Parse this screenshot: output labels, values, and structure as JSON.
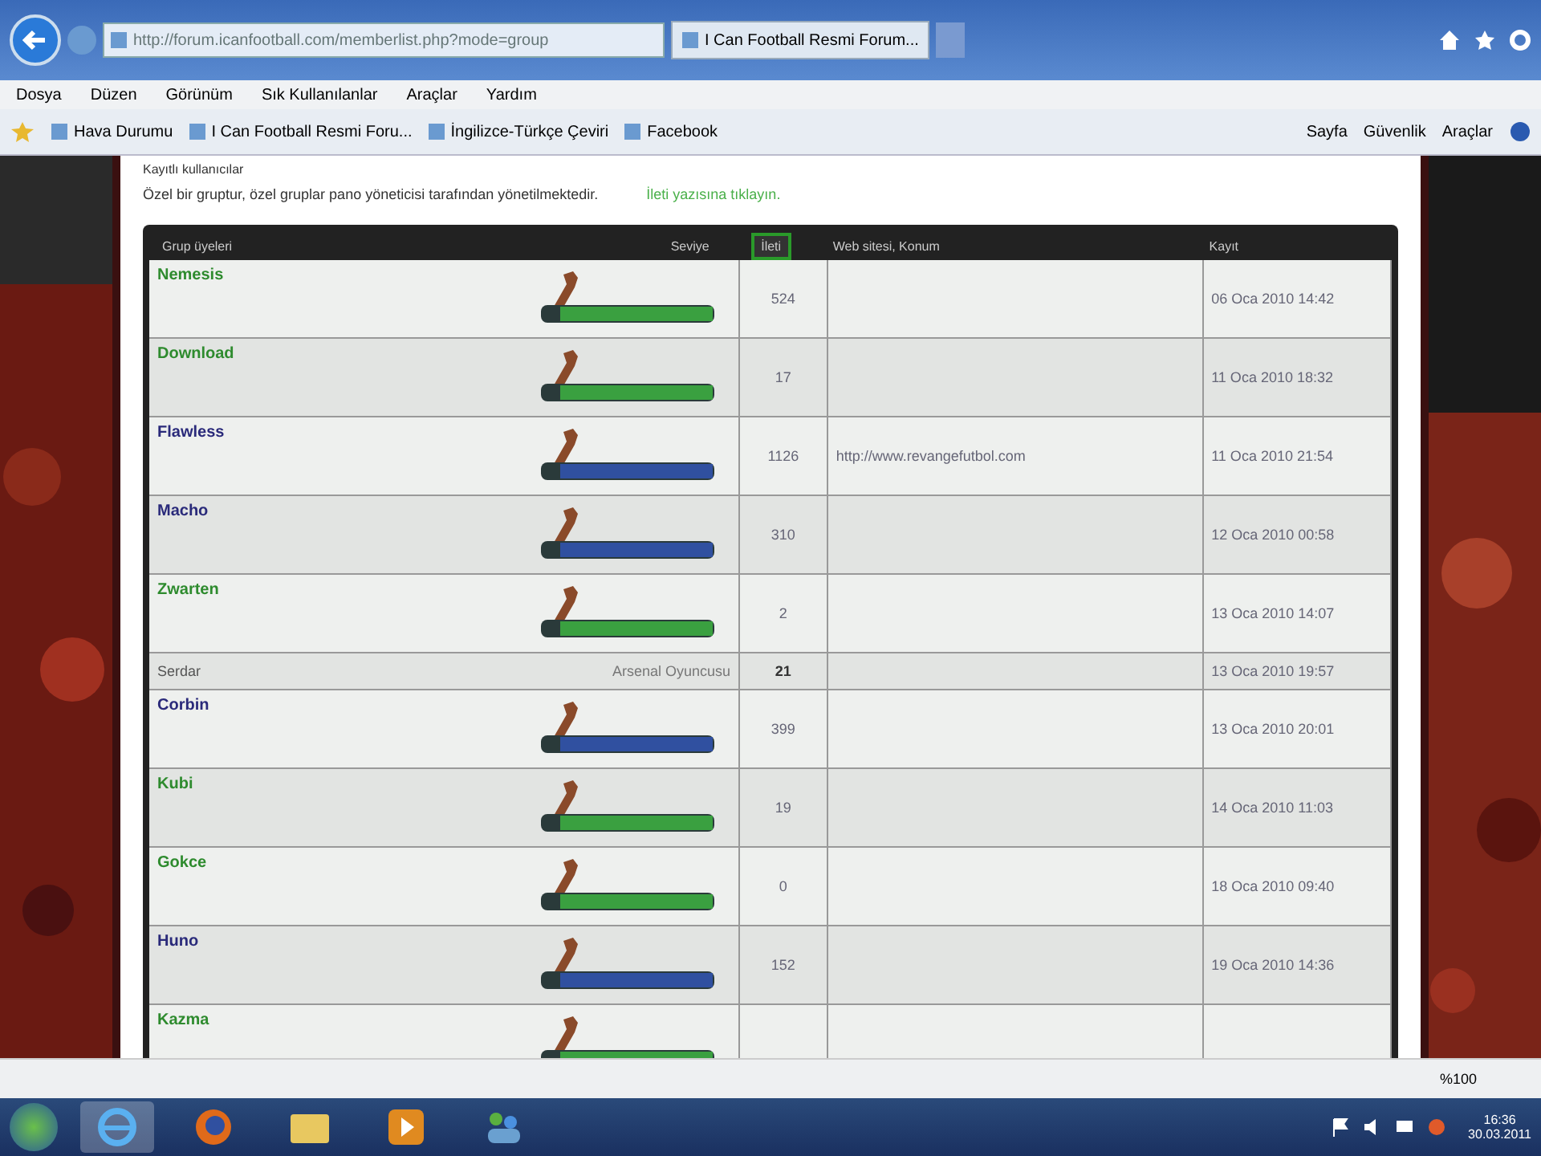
{
  "browser": {
    "address": "http://forum.icanfootball.com/memberlist.php?mode=group",
    "tab": "I Can Football Resmi Forum...",
    "menu": [
      "Dosya",
      "Düzen",
      "Görünüm",
      "Sık Kullanılanlar",
      "Araçlar",
      "Yardım"
    ],
    "favorites": [
      "Hava Durumu",
      "I Can Football Resmi Foru...",
      "İngilizce-Türkçe Çeviri",
      "Facebook"
    ],
    "commands": [
      "Sayfa",
      "Güvenlik",
      "Araçlar"
    ],
    "zoom": "%100"
  },
  "page": {
    "breadcrumb": "Kayıtlı kullanıcılar",
    "description": "Özel bir gruptur, özel gruplar pano yöneticisi tarafından yönetilmektedir.",
    "hint": "İleti yazısına tıklayın."
  },
  "table": {
    "columns": [
      {
        "label": "Grup üyeleri",
        "selected": false
      },
      {
        "label": "Seviye",
        "selected": false
      },
      {
        "label": "İleti",
        "selected": true
      },
      {
        "label": "Web sitesi, Konum",
        "selected": false
      },
      {
        "label": "Kayıt",
        "selected": false
      }
    ],
    "rows": [
      {
        "name": "Nemesis",
        "color": "#2e8b2e",
        "kind": "badge",
        "posts": "524",
        "joined": "06 Oca 2010 14:42"
      },
      {
        "name": "Download",
        "color": "#2e8b2e",
        "kind": "badge",
        "posts": "17",
        "joined": "11 Oca 2010 18:32"
      },
      {
        "name": "Flawless",
        "color": "#2a2a7a",
        "kind": "badge",
        "posts": "1126",
        "website": "http://www.revangefutbol.com",
        "joined": "11 Oca 2010 21:54"
      },
      {
        "name": "Macho",
        "color": "#2a2a7a",
        "kind": "badge",
        "posts": "310",
        "joined": "12 Oca 2010 00:58"
      },
      {
        "name": "Zwarten",
        "color": "#2e8b2e",
        "kind": "badge",
        "posts": "2",
        "joined": "13 Oca 2010 14:07"
      },
      {
        "name": "Serdar",
        "kind": "text",
        "rank": "Arsenal Oyuncusu",
        "posts": "21",
        "joined": "13 Oca 2010 19:57"
      },
      {
        "name": "Corbin",
        "color": "#2a2a7a",
        "kind": "badge",
        "posts": "399",
        "joined": "13 Oca 2010 20:01"
      },
      {
        "name": "Kubi",
        "color": "#2e8b2e",
        "kind": "badge",
        "posts": "19",
        "joined": "14 Oca 2010 11:03"
      },
      {
        "name": "Gokce",
        "color": "#2e8b2e",
        "kind": "badge",
        "posts": "0",
        "joined": "18 Oca 2010 09:40"
      },
      {
        "name": "Huno",
        "color": "#2a2a7a",
        "kind": "badge",
        "posts": "152",
        "joined": "19 Oca 2010 14:36"
      },
      {
        "name": "Kazma",
        "color": "#2e8b2e",
        "kind": "badge"
      }
    ]
  },
  "taskbar": {
    "time": "16:36",
    "date": "30.03.2011"
  }
}
